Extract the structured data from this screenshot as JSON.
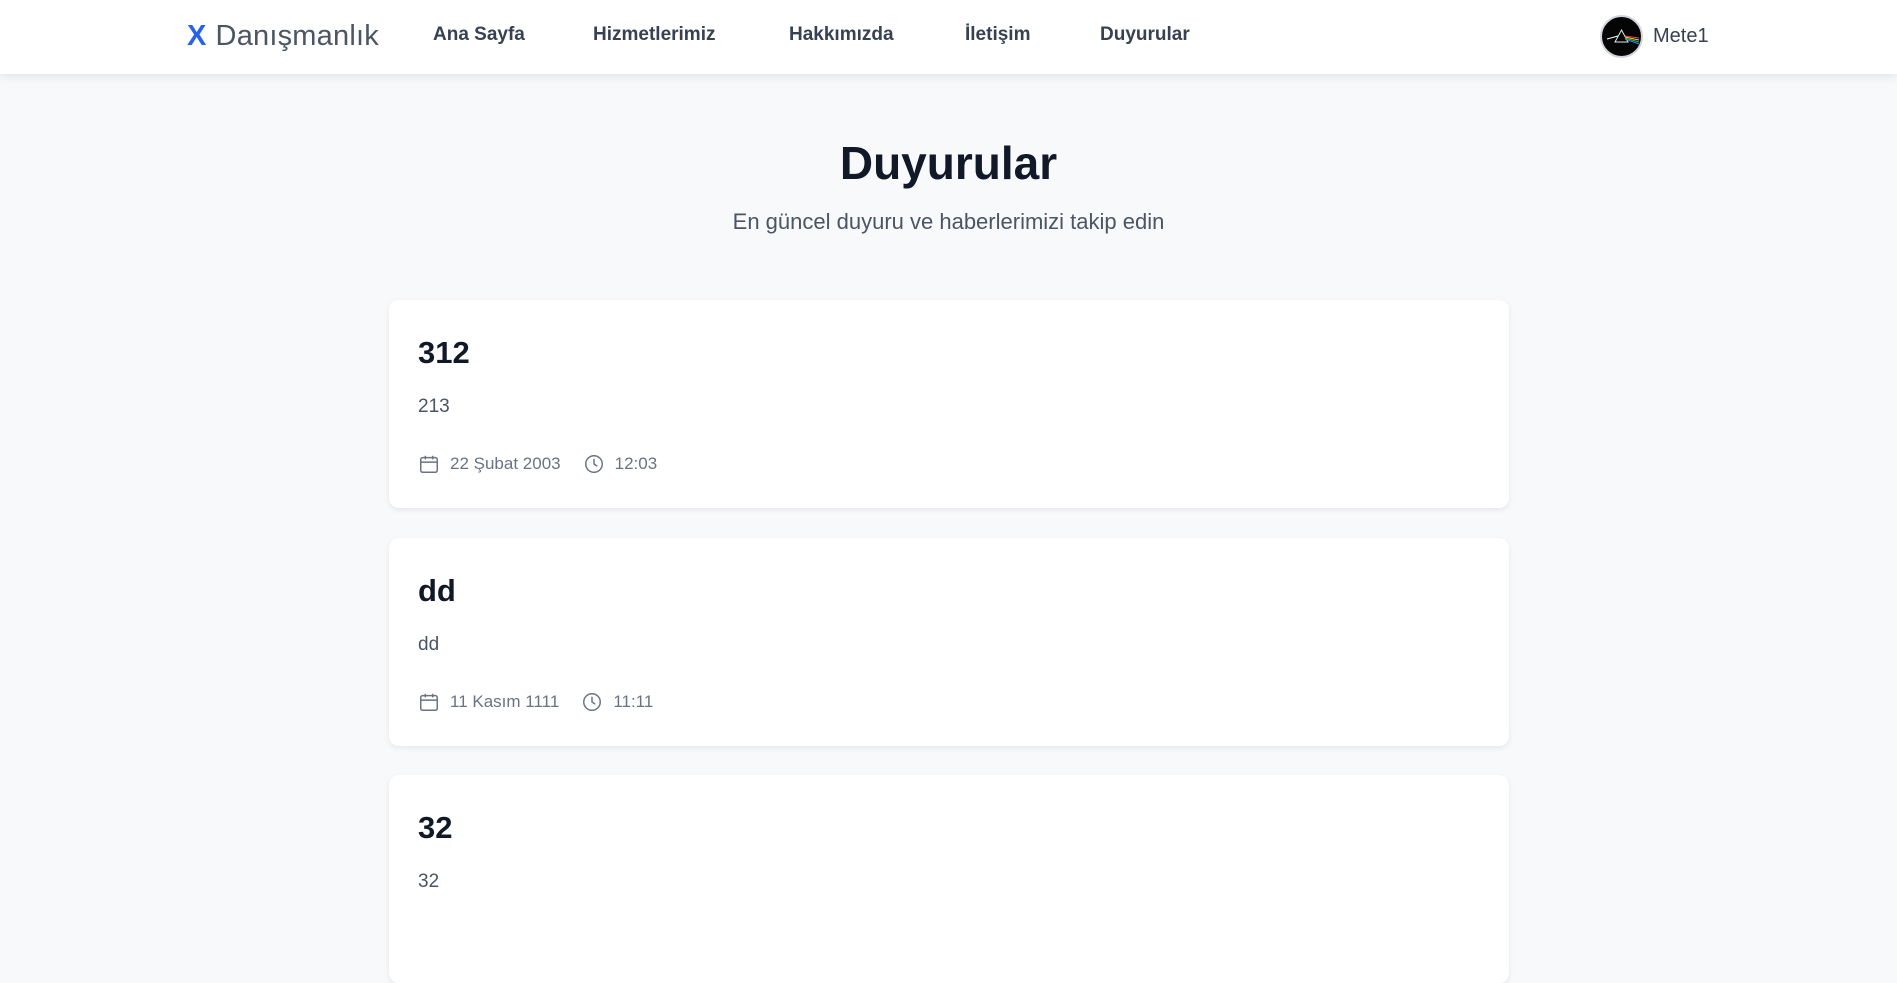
{
  "brand": {
    "mark": "X",
    "name": "Danışmanlık",
    "accent": "#2563eb"
  },
  "nav": {
    "items": [
      {
        "label": "Ana Sayfa"
      },
      {
        "label": "Hizmetlerimiz"
      },
      {
        "label": "Hakkımızda"
      },
      {
        "label": "İletişim"
      },
      {
        "label": "Duyurular"
      }
    ]
  },
  "user": {
    "name": "Mete1",
    "avatar_icon": "prism-avatar"
  },
  "page": {
    "title": "Duyurular",
    "subtitle": "En güncel duyuru ve haberlerimizi takip edin"
  },
  "announcements": [
    {
      "title": "312",
      "body": "213",
      "date": "22 Şubat 2003",
      "time": "12:03"
    },
    {
      "title": "dd",
      "body": "dd",
      "date": "11 Kasım 1111",
      "time": "11:11"
    },
    {
      "title": "32",
      "body": "32"
    }
  ],
  "icons": {
    "date": "calendar-icon",
    "time": "clock-icon"
  }
}
